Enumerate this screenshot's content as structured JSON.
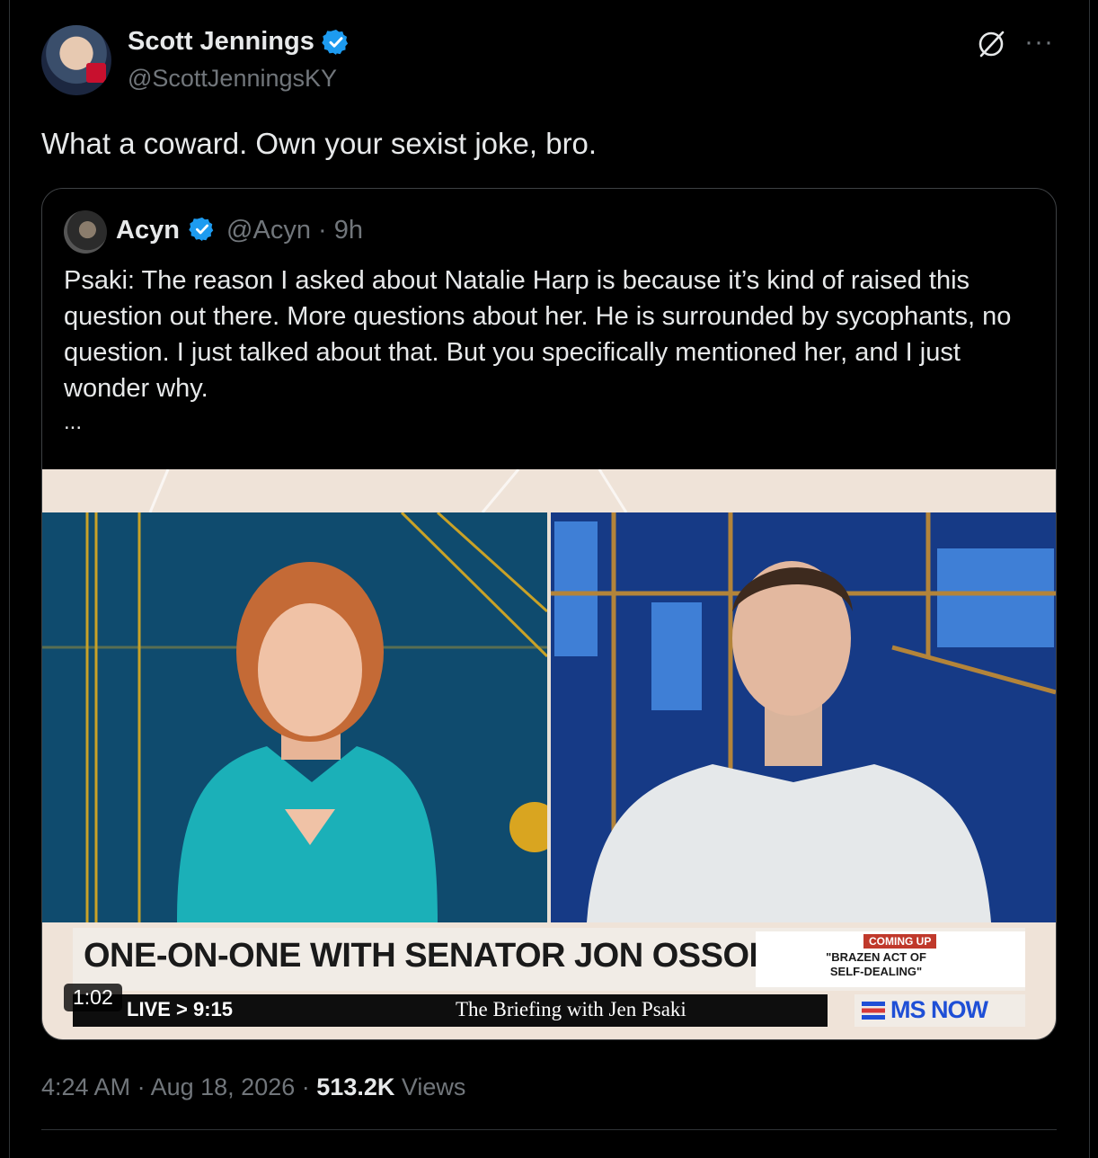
{
  "post": {
    "author_name": "Scott Jennings",
    "author_handle": "@ScottJenningsKY",
    "text": "What a coward. Own your sexist joke, bro.",
    "time": "4:24 AM",
    "date": "Aug 18, 2026",
    "views_count": "513.2K",
    "views_label": "Views",
    "separator": "·"
  },
  "quoted": {
    "author_name": "Acyn",
    "author_handle": "@Acyn",
    "age": "9h",
    "text": "Psaki: The reason I asked about Natalie Harp is because it’s kind of raised this question out there. More questions about her. He is surrounded by sycophants, no question. I just talked about that. But you specifically mentioned her, and I just wonder why.",
    "ellipsis": "...",
    "video": {
      "duration": "1:02",
      "chyron": "ONE-ON-ONE WITH SENATOR JON OSSOFF",
      "ticker_live": "LIVE > 9:15",
      "ticker_show": "The Briefing with Jen Psaki",
      "coming_up": "COMING UP",
      "promo": "\"BRAZEN ACT OF SELF-DEALING\"",
      "network": "MS NOW"
    }
  },
  "icons": {
    "verified": "verified-badge-icon",
    "grok": "grok-icon",
    "more": "more-icon"
  },
  "colors": {
    "verified": "#1d9bf0",
    "background": "#000000",
    "secondary_text": "#71767b"
  }
}
